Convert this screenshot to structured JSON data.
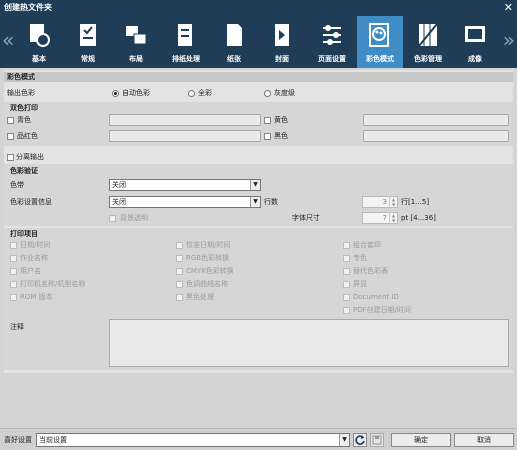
{
  "window": {
    "title": "创建热文件夹"
  },
  "tabs": [
    {
      "label": "基本",
      "icon": "basic-settings-icon"
    },
    {
      "label": "常规",
      "icon": "general-icon"
    },
    {
      "label": "布局",
      "icon": "layout-icon"
    },
    {
      "label": "排纸处理",
      "icon": "output-handling-icon"
    },
    {
      "label": "纸张",
      "icon": "paper-icon"
    },
    {
      "label": "封面",
      "icon": "cover-icon"
    },
    {
      "label": "页面设置",
      "icon": "page-setup-icon"
    },
    {
      "label": "彩色模式",
      "icon": "color-mode-icon"
    },
    {
      "label": "色彩管理",
      "icon": "color-management-icon"
    },
    {
      "label": "成像",
      "icon": "imaging-icon"
    }
  ],
  "color_mode": {
    "section_title": "彩色模式",
    "output_color_label": "输出色彩",
    "options": [
      "自动色彩",
      "全彩",
      "灰度级"
    ],
    "selected": "自动色彩"
  },
  "two_color": {
    "title": "双色打印",
    "cyan": "青色",
    "yellow": "黄色",
    "magenta": "品红色",
    "black": "黑色"
  },
  "separation": {
    "label": "分离输出"
  },
  "verification": {
    "title": "色彩验证",
    "color_band_label": "色带",
    "color_band_value": "关闭",
    "settings_info_label": "色彩设置信息",
    "settings_info_value": "关闭",
    "lines_label": "行数",
    "lines_value": "3",
    "lines_range": "行[1...5]",
    "background_transparent": "背景透明",
    "font_size_label": "字体尺寸",
    "font_size_value": "7",
    "font_size_range": "pt [4...36]"
  },
  "print_items": {
    "title": "打印项目",
    "col1": [
      "日期/时间",
      "作业名称",
      "用户名",
      "打印机名称/机型名称",
      "ROM 版本"
    ],
    "col2": [
      "校准日期/时间",
      "RGB色彩转换",
      "CMYK色彩转换",
      "色调曲线名称",
      "黑色处理"
    ],
    "col3": [
      "组合套印",
      "专色",
      "替代色彩表",
      "屏显",
      "Document ID",
      "PDF创建日期/时间"
    ]
  },
  "notes": {
    "label": "注释"
  },
  "footer": {
    "preference_label": "喜好设置",
    "preference_value": "当前设置",
    "ok": "确定",
    "cancel": "取消"
  }
}
